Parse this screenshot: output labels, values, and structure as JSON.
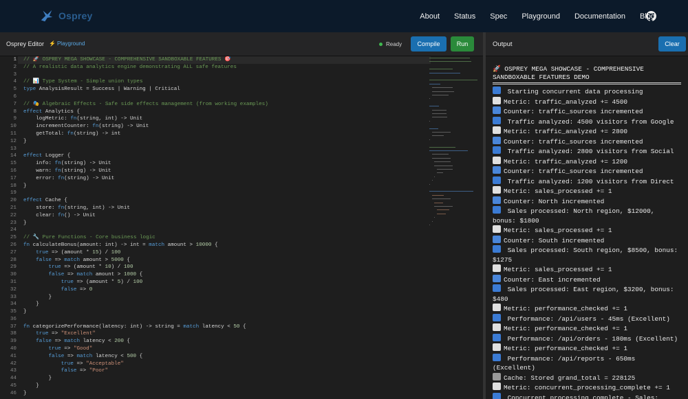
{
  "nav": {
    "brand": "Osprey",
    "links": [
      "About",
      "Status",
      "Spec",
      "Playground",
      "Documentation",
      "Blog"
    ]
  },
  "editor": {
    "title": "Osprey Editor",
    "playground_label": "Playground",
    "status": "Ready",
    "compile_label": "Compile",
    "run_label": "Run",
    "lines": [
      "// 🚀 OSPREY MEGA SHOWCASE - COMPREHENSIVE SANDBOXABLE FEATURES 🎯",
      "// A realistic data analytics engine demonstrating ALL safe features",
      "",
      "// 📊 Type System - Simple union types",
      "type AnalysisResult = Success | Warning | Critical",
      "",
      "// 🎭 Algebraic Effects - Safe side effects management (from working examples)",
      "effect Analytics {",
      "    logMetric: fn(string, int) -> Unit",
      "    incrementCounter: fn(string) -> Unit",
      "    getTotal: fn(string) -> int",
      "}",
      "",
      "effect Logger {",
      "    info: fn(string) -> Unit",
      "    warn: fn(string) -> Unit",
      "    error: fn(string) -> Unit",
      "}",
      "",
      "effect Cache {",
      "    store: fn(string, int) -> Unit",
      "    clear: fn() -> Unit",
      "}",
      "",
      "// 🔧 Pure Functions - Core business logic",
      "fn calculateBonus(amount: int) -> int = match amount > 10000 {",
      "    true => (amount * 15) / 100",
      "    false => match amount > 5000 {",
      "        true => (amount * 10) / 100",
      "        false => match amount > 1000 {",
      "            true => (amount * 5) / 100",
      "            false => 0",
      "        }",
      "    }",
      "}",
      "",
      "fn categorizePerformance(latency: int) -> string = match latency < 50 {",
      "    true => \"Excellent\"",
      "    false => match latency < 200 {",
      "        true => \"Good\"",
      "        false => match latency < 500 {",
      "            true => \"Acceptable\"",
      "            false => \"Poor\"",
      "        }",
      "    }",
      "}"
    ]
  },
  "output": {
    "title": "Output",
    "clear_label": "Clear",
    "heading": "🚀 OSPREY MEGA SHOWCASE - COMPREHENSIVE SANDBOXABLE FEATURES DEMO",
    "lines": [
      {
        "icon": "info",
        "text": " Starting concurrent data processing"
      },
      {
        "icon": "chart",
        "text": "Metric: traffic_analyzed += 4500"
      },
      {
        "icon": "counter",
        "text": "Counter: traffic_sources incremented"
      },
      {
        "icon": "info",
        "text": " Traffic analyzed: 4500 visitors from Google"
      },
      {
        "icon": "chart",
        "text": "Metric: traffic_analyzed += 2800"
      },
      {
        "icon": "counter",
        "text": "Counter: traffic_sources incremented"
      },
      {
        "icon": "info",
        "text": " Traffic analyzed: 2800 visitors from Social"
      },
      {
        "icon": "chart",
        "text": "Metric: traffic_analyzed += 1200"
      },
      {
        "icon": "counter",
        "text": "Counter: traffic_sources incremented"
      },
      {
        "icon": "info",
        "text": " Traffic analyzed: 1200 visitors from Direct"
      },
      {
        "icon": "chart",
        "text": "Metric: sales_processed += 1"
      },
      {
        "icon": "counter",
        "text": "Counter: North incremented"
      },
      {
        "icon": "info",
        "text": " Sales processed: North region, $12000, bonus: $1800"
      },
      {
        "icon": "chart",
        "text": "Metric: sales_processed += 1"
      },
      {
        "icon": "counter",
        "text": "Counter: South incremented"
      },
      {
        "icon": "info",
        "text": " Sales processed: South region, $8500, bonus: $1275"
      },
      {
        "icon": "chart",
        "text": "Metric: sales_processed += 1"
      },
      {
        "icon": "counter",
        "text": "Counter: East incremented"
      },
      {
        "icon": "info",
        "text": " Sales processed: East region, $3200, bonus: $480"
      },
      {
        "icon": "chart",
        "text": "Metric: performance_checked += 1"
      },
      {
        "icon": "info",
        "text": " Performance: /api/users - 45ms (Excellent)"
      },
      {
        "icon": "chart",
        "text": "Metric: performance_checked += 1"
      },
      {
        "icon": "info",
        "text": " Performance: /api/orders - 180ms (Excellent)"
      },
      {
        "icon": "chart",
        "text": "Metric: performance_checked += 1"
      },
      {
        "icon": "info",
        "text": " Performance: /api/reports - 650ms (Excellent)"
      },
      {
        "icon": "cache",
        "text": "Cache: Stored grand_total = 228125"
      },
      {
        "icon": "chart",
        "text": "Metric: concurrent_processing_complete += 1"
      },
      {
        "icon": "info",
        "text": " Concurrent processing complete - Sales:"
      }
    ]
  }
}
